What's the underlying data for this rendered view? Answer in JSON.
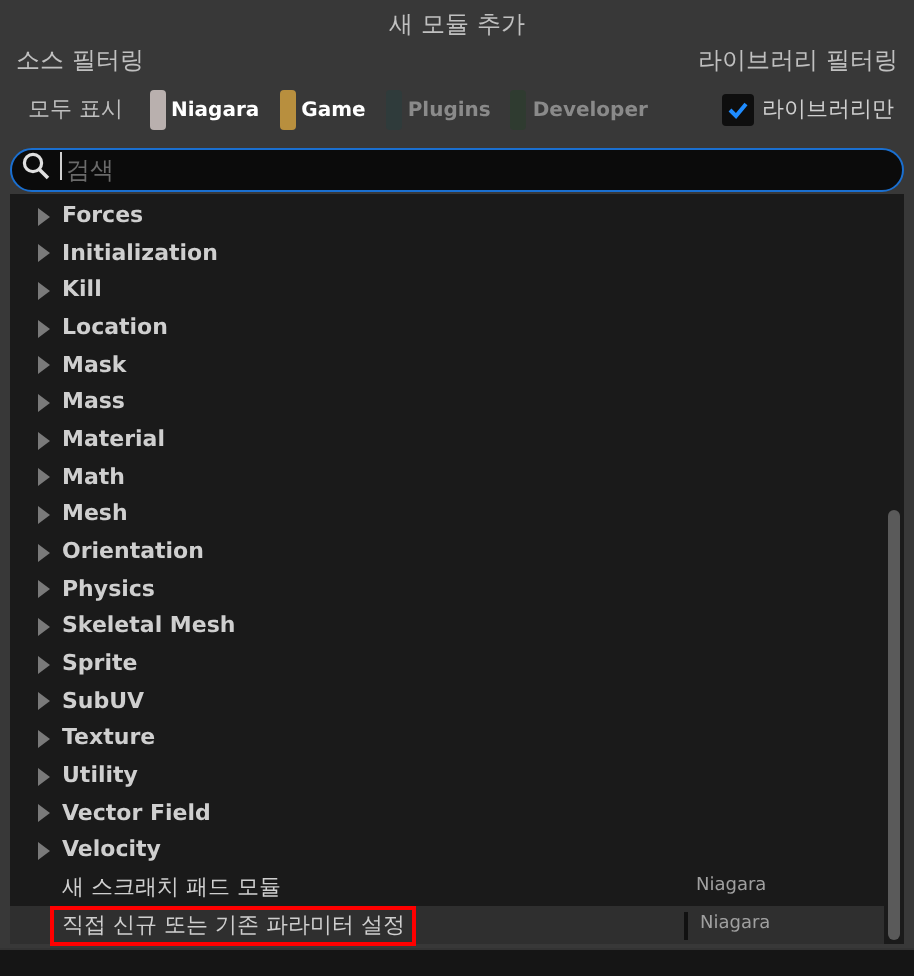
{
  "window": {
    "title": "새 모듈 추가"
  },
  "source_filter": {
    "label": "소스 필터링",
    "show_all": "모두 표시",
    "chips": [
      {
        "label": "Niagara",
        "color": "#b9b0ae",
        "on": true
      },
      {
        "label": "Game",
        "color": "#b88f3e",
        "on": true
      },
      {
        "label": "Plugins",
        "color": "#2f3b3b",
        "on": false
      },
      {
        "label": "Developer",
        "color": "#2f3b30",
        "on": false
      }
    ]
  },
  "library_filter": {
    "label": "라이브러리 필터링",
    "checkbox": {
      "label": "라이브러리만",
      "checked": true
    }
  },
  "search": {
    "placeholder": "검색"
  },
  "items": [
    {
      "kind": "category",
      "label": "Forces",
      "expanded": false,
      "selected": false
    },
    {
      "kind": "category",
      "label": "Initialization",
      "expanded": false,
      "selected": false
    },
    {
      "kind": "category",
      "label": "Kill",
      "expanded": false,
      "selected": false
    },
    {
      "kind": "category",
      "label": "Location",
      "expanded": false,
      "selected": false
    },
    {
      "kind": "category",
      "label": "Mask",
      "expanded": false,
      "selected": false
    },
    {
      "kind": "category",
      "label": "Mass",
      "expanded": false,
      "selected": false
    },
    {
      "kind": "category",
      "label": "Material",
      "expanded": false,
      "selected": false
    },
    {
      "kind": "category",
      "label": "Math",
      "expanded": false,
      "selected": false
    },
    {
      "kind": "category",
      "label": "Mesh",
      "expanded": false,
      "selected": false
    },
    {
      "kind": "category",
      "label": "Orientation",
      "expanded": false,
      "selected": false
    },
    {
      "kind": "category",
      "label": "Physics",
      "expanded": false,
      "selected": false
    },
    {
      "kind": "category",
      "label": "Skeletal Mesh",
      "expanded": false,
      "selected": false
    },
    {
      "kind": "category",
      "label": "Sprite",
      "expanded": false,
      "selected": false
    },
    {
      "kind": "category",
      "label": "SubUV",
      "expanded": false,
      "selected": false
    },
    {
      "kind": "category",
      "label": "Texture",
      "expanded": false,
      "selected": false
    },
    {
      "kind": "category",
      "label": "Utility",
      "expanded": false,
      "selected": false
    },
    {
      "kind": "category",
      "label": "Vector Field",
      "expanded": false,
      "selected": false
    },
    {
      "kind": "category",
      "label": "Velocity",
      "expanded": false,
      "selected": false
    },
    {
      "kind": "module",
      "label": "새 스크래치 패드 모듈",
      "source": "Niagara",
      "selected": false,
      "annotated": false
    },
    {
      "kind": "module",
      "label": "직접 신규 또는 기존 파라미터 설정",
      "source": "Niagara",
      "selected": true,
      "annotated": true
    }
  ]
}
